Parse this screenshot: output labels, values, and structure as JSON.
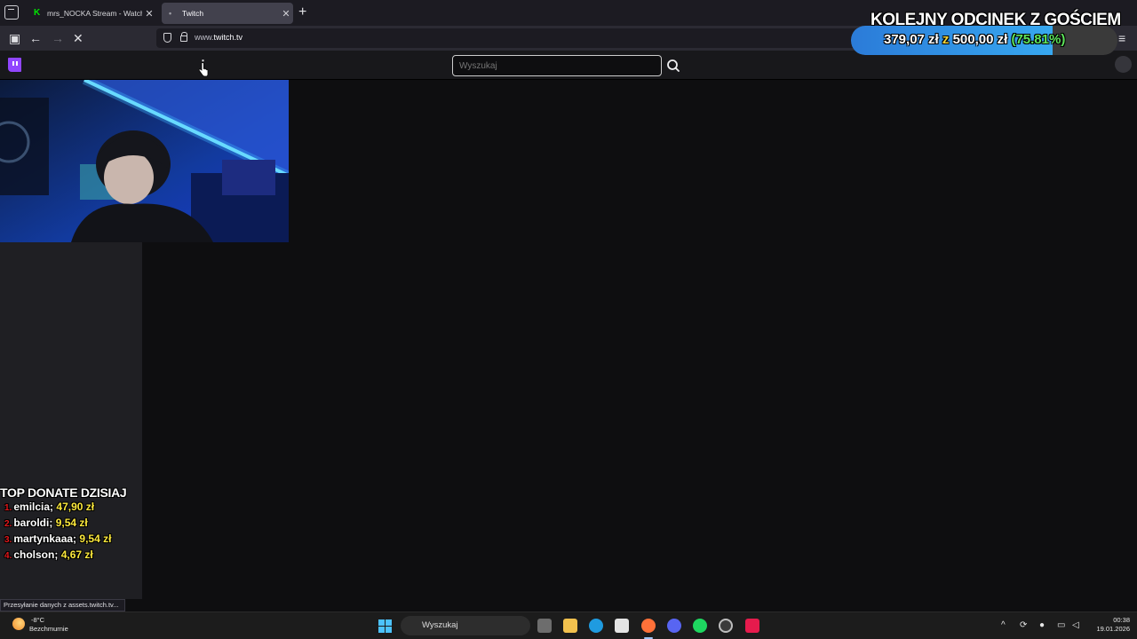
{
  "browser": {
    "tabs": [
      {
        "title": "mrs_NOCKA Stream - Watch Li",
        "active": false,
        "favicon": "kick-icon"
      },
      {
        "title": "Twitch",
        "active": true,
        "favicon": "loading-icon"
      }
    ],
    "url_host": "www.",
    "url_domain": "twitch.tv",
    "status_text": "Przesyłanie danych z assets.twitch.tv..."
  },
  "twitch": {
    "search_placeholder": "Wyszukaj",
    "brand_color": "#9146ff"
  },
  "overlay": {
    "goal_title": "KOLEJNY ODCINEK Z GOŚCIEM",
    "goal_current": "379,07 zł",
    "goal_sep": "z",
    "goal_target": "500,00 zł",
    "goal_percent": "(75.81%)",
    "goal_progress": 0.7581,
    "donors_title": "TOP DONATE DZISIAJ",
    "donors": [
      {
        "rank": "1.",
        "name": "emilcia;",
        "amount": "47,90 zł"
      },
      {
        "rank": "2.",
        "name": "baroldi;",
        "amount": "9,54 zł"
      },
      {
        "rank": "3.",
        "name": "martynkaaa;",
        "amount": "9,54 zł"
      },
      {
        "rank": "4.",
        "name": "cholson;",
        "amount": "4,67 zł"
      }
    ]
  },
  "taskbar": {
    "weather_temp": "-8°C",
    "weather_desc": "Bezchmurnie",
    "search_label": "Wyszukaj",
    "time": "00:38",
    "date": "19.01.2026"
  }
}
